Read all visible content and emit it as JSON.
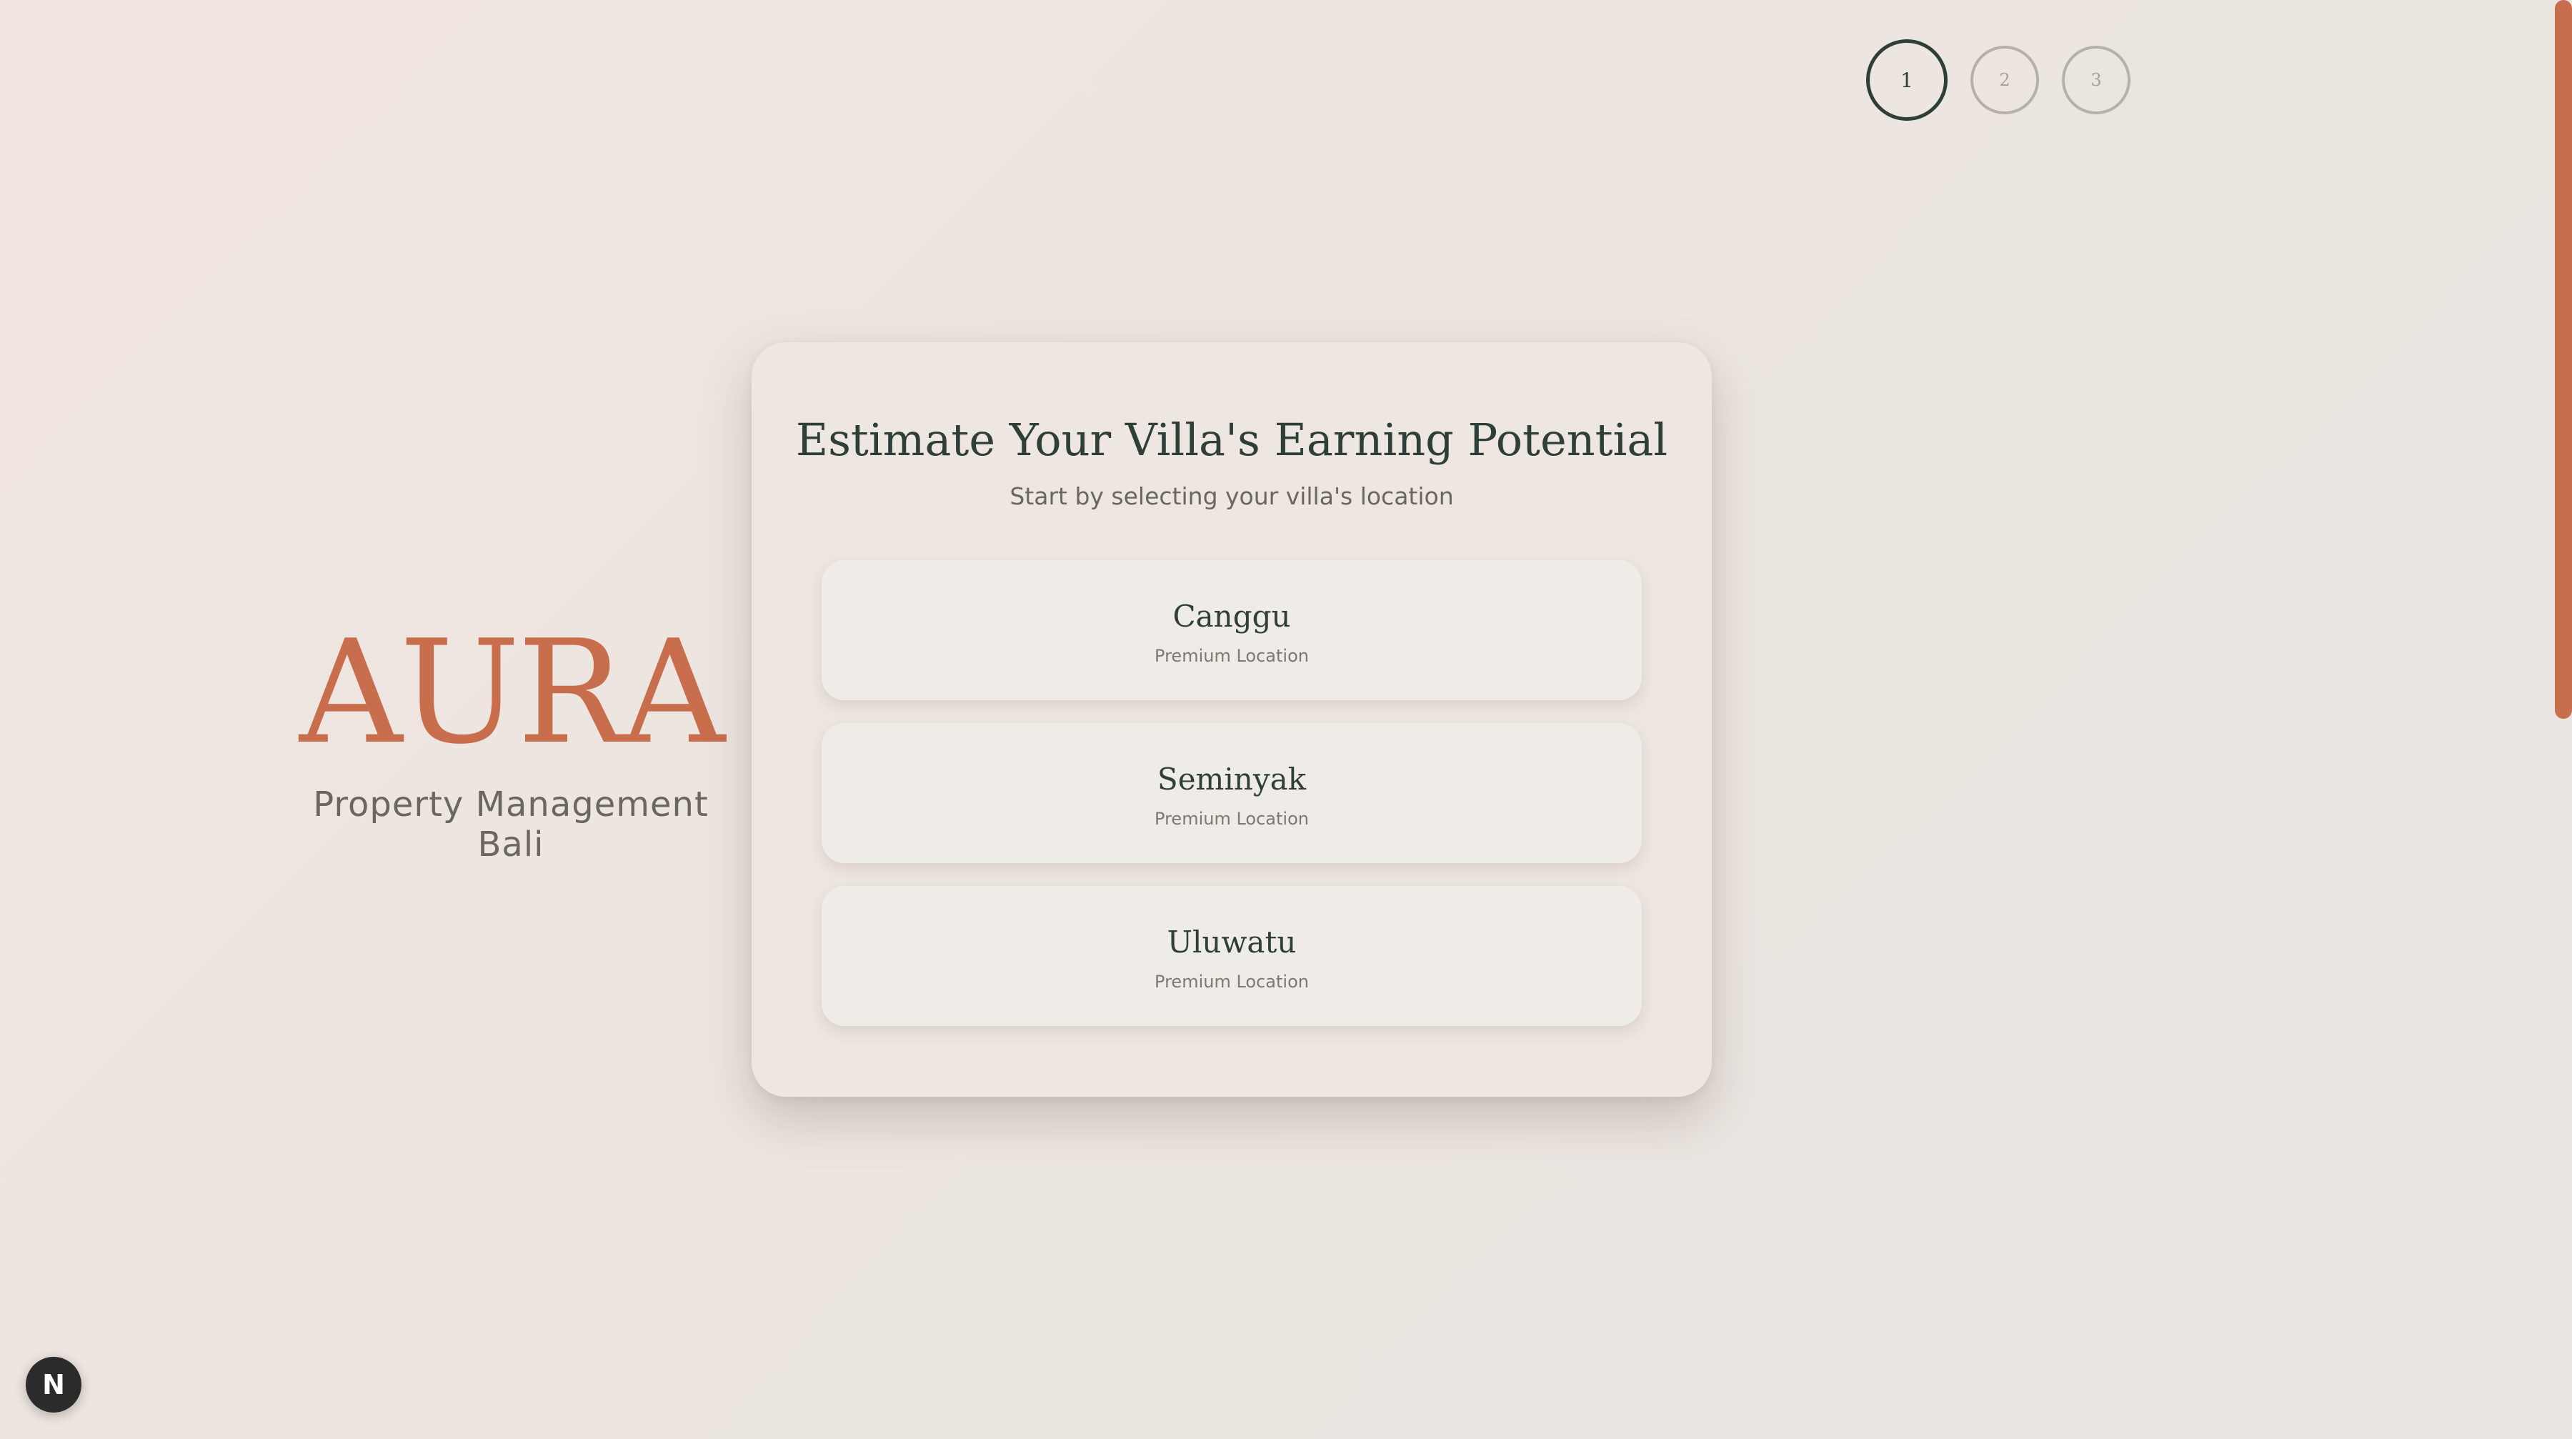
{
  "stepper": {
    "steps": [
      {
        "label": "1",
        "state": "active"
      },
      {
        "label": "2",
        "state": "inactive"
      },
      {
        "label": "3",
        "state": "inactive"
      }
    ]
  },
  "brand": {
    "name": "AURA",
    "tagline": "Property Management Bali"
  },
  "card": {
    "title": "Estimate Your Villa's Earning Potential",
    "subtitle": "Start by selecting your villa's location",
    "options": [
      {
        "name": "Canggu",
        "description": "Premium Location"
      },
      {
        "name": "Seminyak",
        "description": "Premium Location"
      },
      {
        "name": "Uluwatu",
        "description": "Premium Location"
      }
    ]
  },
  "dev_badge": {
    "label": "N"
  },
  "colors": {
    "accent": "#c96e4c",
    "primary_text": "#2e3f37",
    "muted_text": "#6a6660"
  }
}
